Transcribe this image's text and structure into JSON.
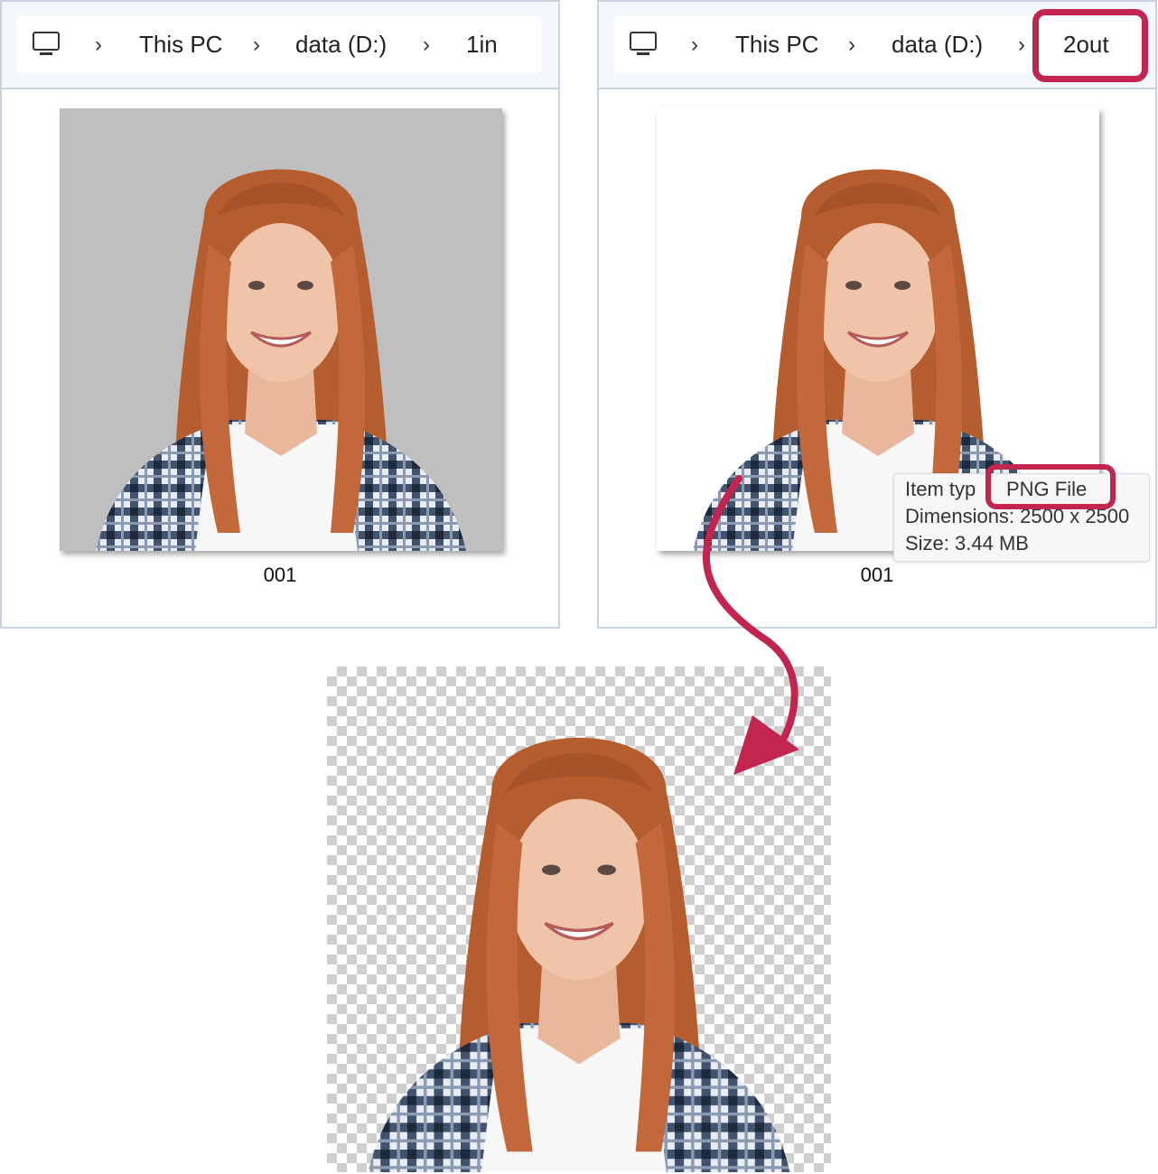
{
  "left_window": {
    "breadcrumb": {
      "icon": "pc-icon",
      "items": [
        "This PC",
        "data (D:)",
        "1in"
      ]
    },
    "file": {
      "name": "001",
      "background": "#bdbdbd"
    }
  },
  "right_window": {
    "breadcrumb": {
      "icon": "pc-icon",
      "items": [
        "This PC",
        "data (D:)",
        "2out"
      ],
      "highlighted_item": "2out"
    },
    "file": {
      "name": "001",
      "background": "#ffffff"
    },
    "tooltip": {
      "item_type_label": "Item typ",
      "item_type_value": "PNG File",
      "dimensions": "Dimensions: 2500 x 2500",
      "size": "Size: 3.44 MB"
    }
  },
  "result_image": {
    "background": "transparent-checkerboard"
  },
  "colors": {
    "highlight": "#c2254f",
    "arrow": "#c2254f",
    "border": "#c9d3df"
  }
}
